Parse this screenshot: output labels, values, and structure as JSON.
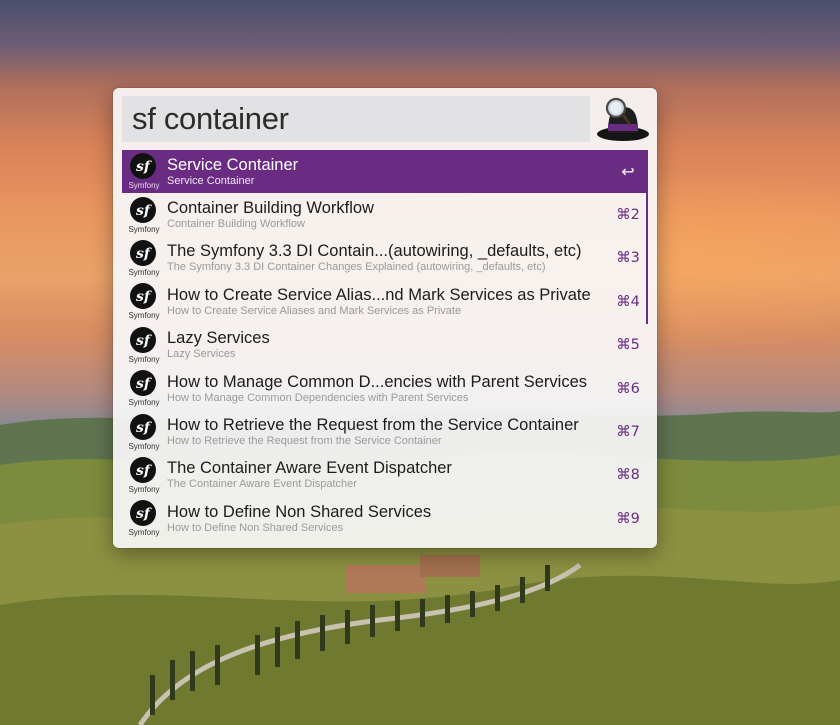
{
  "search": {
    "query": "sf container"
  },
  "app_icon": "alfred-hat-icon",
  "result_icon": {
    "name": "symfony-icon",
    "label": "Symfony",
    "glyph": "sf"
  },
  "colors": {
    "accent": "#6a2c82",
    "panel": "#f8f8f9"
  },
  "results": [
    {
      "title": "Service Container",
      "subtitle": "Service Container",
      "shortcut": "↩",
      "selected": true
    },
    {
      "title": "Container Building Workflow",
      "subtitle": "Container Building Workflow",
      "shortcut": "⌘2"
    },
    {
      "title": "The Symfony 3.3 DI Contain...(autowiring, _defaults, etc)",
      "subtitle": "The Symfony 3.3 DI Container Changes Explained (autowiring, _defaults, etc)",
      "shortcut": "⌘3"
    },
    {
      "title": "How to Create Service Alias...nd Mark Services as Private",
      "subtitle": "How to Create Service Aliases and Mark Services as Private",
      "shortcut": "⌘4"
    },
    {
      "title": "Lazy Services",
      "subtitle": "Lazy Services",
      "shortcut": "⌘5"
    },
    {
      "title": "How to Manage Common D...encies with Parent Services",
      "subtitle": "How to Manage Common Dependencies with Parent Services",
      "shortcut": "⌘6"
    },
    {
      "title": "How to Retrieve the Request from the Service Container",
      "subtitle": "How to Retrieve the Request from the Service Container",
      "shortcut": "⌘7"
    },
    {
      "title": "The Container Aware Event Dispatcher",
      "subtitle": "The Container Aware Event Dispatcher",
      "shortcut": "⌘8"
    },
    {
      "title": "How to Define Non Shared Services",
      "subtitle": "How to Define Non Shared Services",
      "shortcut": "⌘9"
    }
  ]
}
